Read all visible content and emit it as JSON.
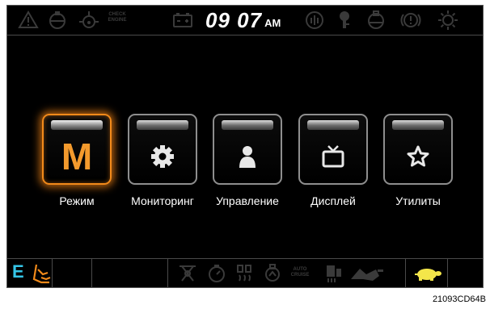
{
  "status_bar": {
    "clock_time": "09 07",
    "clock_period": "AM",
    "check_engine_line1": "CHECK",
    "check_engine_line2": "ENGINE",
    "icons": [
      "warning-triangle-icon",
      "engine-oil-icon",
      "coolant-temp-icon",
      "check-engine-icon",
      "battery-icon",
      "air-cleaner-icon",
      "preheat-icon",
      "fuel-icon",
      "brake-icon",
      "overload-icon"
    ]
  },
  "menu": {
    "items": [
      {
        "label": "Режим",
        "icon": "mode-m-icon",
        "glyph": "M",
        "active": true
      },
      {
        "label": "Мониторинг",
        "icon": "gear-icon",
        "active": false
      },
      {
        "label": "Управление",
        "icon": "user-icon",
        "active": false
      },
      {
        "label": "Дисплей",
        "icon": "tv-icon",
        "active": false
      },
      {
        "label": "Утилиты",
        "icon": "star-icon",
        "active": false
      }
    ],
    "active_color": "#f28a1a"
  },
  "bottom_bar": {
    "mode_letter": "E",
    "mode_color": "#35c6e8",
    "auto_cruise_line1": "AUTO",
    "auto_cruise_line2": "CRUISE",
    "speed_indicator_color": "#f4e64a",
    "icons": [
      "work-mode-icon",
      "boom-icon",
      "rpm-icon",
      "heater-icon",
      "fuel-filter-icon",
      "auto-cruise-icon",
      "attachment-icon",
      "hydraulic-icon",
      "turtle-speed-icon"
    ]
  },
  "caption": "21093CD64B"
}
